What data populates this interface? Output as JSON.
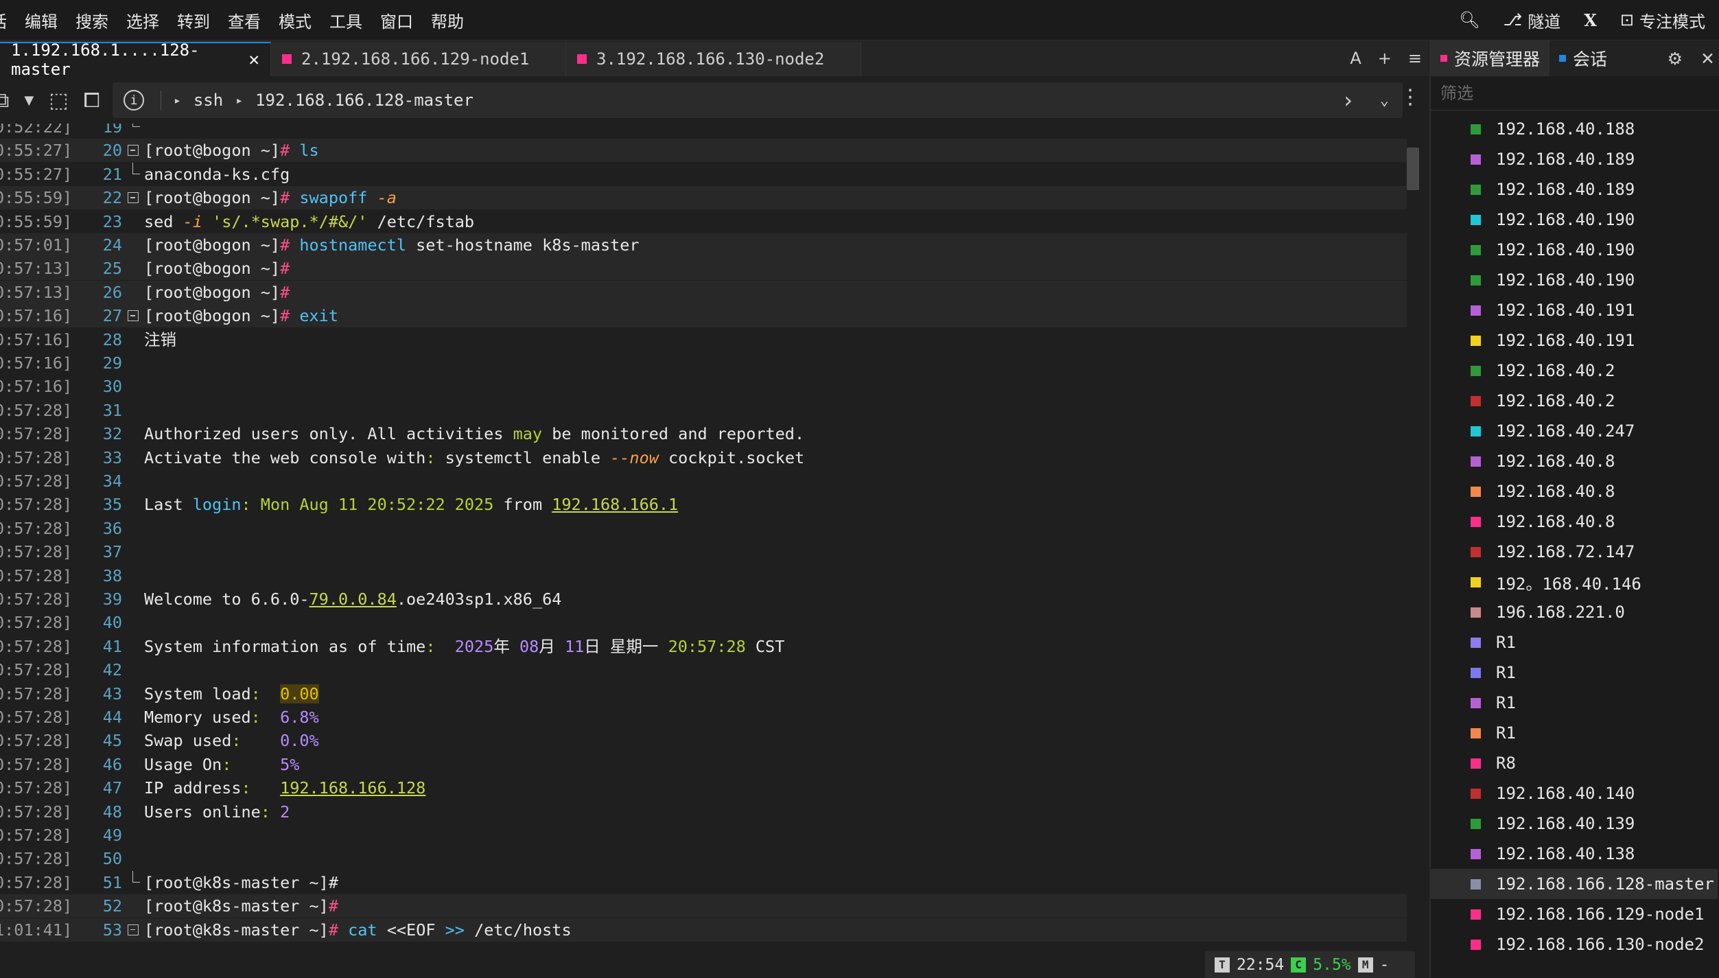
{
  "menu": [
    "话",
    "编辑",
    "搜索",
    "选择",
    "转到",
    "查看",
    "模式",
    "工具",
    "窗口",
    "帮助"
  ],
  "menu_right": {
    "tunnel": "隧道",
    "x": "X",
    "focus": "专注模式"
  },
  "tabs": [
    {
      "label": "1.192.168.1....128-master",
      "close": "✕"
    },
    {
      "label": "2.192.168.166.129-node1"
    },
    {
      "label": "3.192.168.166.130-node2"
    }
  ],
  "tab_tools": {
    "font": "A",
    "add": "+",
    "menu": "≡"
  },
  "address": {
    "proto": "ssh",
    "host": "192.168.166.128-master"
  },
  "terminal": {
    "prompt_bogon": "[root@bogon ~]",
    "prompt_master": "[root@k8s-master ~]",
    "lines": [
      {
        "ts": "0:52:22]",
        "n": "19"
      },
      {
        "ts": "0:55:27]",
        "n": "20",
        "cmd": "ls"
      },
      {
        "ts": "0:55:27]",
        "n": "21",
        "text": "anaconda-ks.cfg"
      },
      {
        "ts": "0:55:59]",
        "n": "22",
        "cmd": "swapoff",
        "opt": "-a"
      },
      {
        "ts": "0:55:59]",
        "n": "23",
        "sed": "sed",
        "sedopt": "-i",
        "sedarg": "'s/.*swap.*/#&/'",
        "sedfile": "/etc/fstab"
      },
      {
        "ts": "0:57:01]",
        "n": "24",
        "cmd": "hostnamectl",
        "args": "set-hostname k8s-master"
      },
      {
        "ts": "0:57:13]",
        "n": "25"
      },
      {
        "ts": "0:57:13]",
        "n": "26"
      },
      {
        "ts": "0:57:16]",
        "n": "27",
        "cmd": "exit"
      },
      {
        "ts": "0:57:16]",
        "n": "28",
        "text": "注销"
      },
      {
        "ts": "0:57:16]",
        "n": "29"
      },
      {
        "ts": "0:57:16]",
        "n": "30"
      },
      {
        "ts": "0:57:28]",
        "n": "31"
      },
      {
        "ts": "0:57:28]",
        "n": "32",
        "a": "Authorized users only. All activities ",
        "b": "may",
        "c": " be monitored and reported."
      },
      {
        "ts": "0:57:28]",
        "n": "33",
        "a": "Activate the web console with",
        "b": ":",
        "c": " systemctl enable ",
        "d": "--now",
        "e": " cockpit.socket"
      },
      {
        "ts": "0:57:28]",
        "n": "34"
      },
      {
        "ts": "0:57:28]",
        "n": "35",
        "a": "Last ",
        "b": "login",
        "c": ": Mon Aug 11 20:52:22 2025",
        "d": " from ",
        "e": "192.168.166.1"
      },
      {
        "ts": "0:57:28]",
        "n": "36"
      },
      {
        "ts": "0:57:28]",
        "n": "37"
      },
      {
        "ts": "0:57:28]",
        "n": "38"
      },
      {
        "ts": "0:57:28]",
        "n": "39",
        "a": "Welcome to 6.6.0-",
        "b": "79.0.0.84",
        "c": ".oe2403sp1.x86_64"
      },
      {
        "ts": "0:57:28]",
        "n": "40"
      },
      {
        "ts": "0:57:28]",
        "n": "41",
        "a": "System information as of time",
        "b": ":",
        "c": "2025",
        "d": "年 ",
        "e": "08",
        "f": "月 ",
        "g": "11",
        "h": "日 星期一 ",
        "i": "20:57:28",
        "j": " CST"
      },
      {
        "ts": "0:57:28]",
        "n": "42"
      },
      {
        "ts": "0:57:28]",
        "n": "43",
        "k": "System load",
        "v": "0.00"
      },
      {
        "ts": "0:57:28]",
        "n": "44",
        "k": "Memory used",
        "v": "6.8%"
      },
      {
        "ts": "0:57:28]",
        "n": "45",
        "k": "Swap used",
        "v": "0.0%"
      },
      {
        "ts": "0:57:28]",
        "n": "46",
        "k": "Usage On",
        "v": "5%"
      },
      {
        "ts": "0:57:28]",
        "n": "47",
        "k": "IP address",
        "v": "192.168.166.128"
      },
      {
        "ts": "0:57:28]",
        "n": "48",
        "k": "Users online",
        "v": "2"
      },
      {
        "ts": "0:57:28]",
        "n": "49"
      },
      {
        "ts": "0:57:28]",
        "n": "50"
      },
      {
        "ts": "0:57:28]",
        "n": "51"
      },
      {
        "ts": "0:57:28]",
        "n": "52"
      },
      {
        "ts": "1:01:41]",
        "n": "53",
        "cmd": "cat",
        "heredoc": "<<EOF",
        "redir": ">>",
        "file": "/etc/hosts"
      }
    ]
  },
  "status": {
    "t": "T",
    "time": "22:54",
    "c": "C",
    "cpu": "5.5%",
    "m": "M",
    "dash": "-"
  },
  "panel": {
    "tab_explorer": "资源管理器",
    "tab_sessions": "会话",
    "filter_placeholder": "筛选",
    "hosts": [
      {
        "name": "192.168.40.188",
        "color": "#2e9b3a"
      },
      {
        "name": "192.168.40.189",
        "color": "#b65fd6"
      },
      {
        "name": "192.168.40.189",
        "color": "#2e9b3a"
      },
      {
        "name": "192.168.40.190",
        "color": "#1fc7d4"
      },
      {
        "name": "192.168.40.190",
        "color": "#2e9b3a"
      },
      {
        "name": "192.168.40.190",
        "color": "#2e9b3a"
      },
      {
        "name": "192.168.40.191",
        "color": "#b65fd6"
      },
      {
        "name": "192.168.40.191",
        "color": "#f2d21b"
      },
      {
        "name": "192.168.40.2",
        "color": "#2e9b3a"
      },
      {
        "name": "192.168.40.2",
        "color": "#c22f2f"
      },
      {
        "name": "192.168.40.247",
        "color": "#1fc7d4"
      },
      {
        "name": "192.168.40.8",
        "color": "#b65fd6"
      },
      {
        "name": "192.168.40.8",
        "color": "#f2884b"
      },
      {
        "name": "192.168.40.8",
        "color": "#ff2d8a"
      },
      {
        "name": "192.168.72.147",
        "color": "#c22f2f"
      },
      {
        "name": "192。168.40.146",
        "color": "#f2d21b"
      },
      {
        "name": "196.168.221.0",
        "color": "#c98a8a"
      },
      {
        "name": "R1",
        "color": "#8e7cf0"
      },
      {
        "name": "R1",
        "color": "#7a7af0"
      },
      {
        "name": "R1",
        "color": "#b65fd6"
      },
      {
        "name": "R1",
        "color": "#f2884b"
      },
      {
        "name": "R8",
        "color": "#ff2d8a"
      },
      {
        "name": "192.168.40.140",
        "color": "#c22f2f"
      },
      {
        "name": "192.168.40.139",
        "color": "#2e9b3a"
      },
      {
        "name": "192.168.40.138",
        "color": "#b65fd6"
      },
      {
        "name": "192.168.166.128-master",
        "color": "#8a8fa8",
        "selected": true
      },
      {
        "name": "192.168.166.129-node1",
        "color": "#ff2d8a"
      },
      {
        "name": "192.168.166.130-node2",
        "color": "#ff2d8a"
      }
    ]
  }
}
